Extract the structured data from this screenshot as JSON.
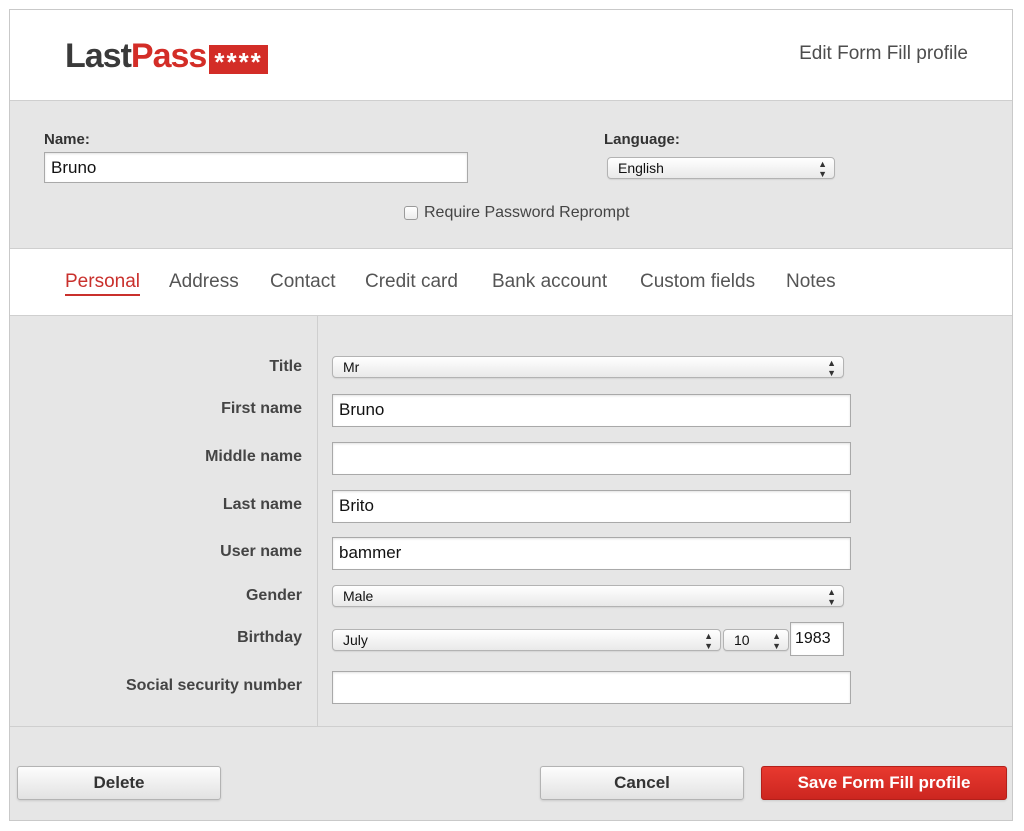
{
  "brand": {
    "logo_last": "Last",
    "logo_pass": "Pass",
    "logo_stars": "****"
  },
  "header": {
    "title": "Edit Form Fill profile"
  },
  "profile": {
    "name_label": "Name:",
    "name_value": "Bruno",
    "language_label": "Language:",
    "language_value": "English",
    "reprompt_label": "Require Password Reprompt",
    "reprompt_checked": false
  },
  "tabs": [
    {
      "label": "Personal",
      "active": true
    },
    {
      "label": "Address"
    },
    {
      "label": "Contact"
    },
    {
      "label": "Credit card"
    },
    {
      "label": "Bank account"
    },
    {
      "label": "Custom fields"
    },
    {
      "label": "Notes"
    }
  ],
  "personal": {
    "title": {
      "label": "Title",
      "value": "Mr"
    },
    "first_name": {
      "label": "First name",
      "value": "Bruno"
    },
    "middle_name": {
      "label": "Middle name",
      "value": ""
    },
    "last_name": {
      "label": "Last name",
      "value": "Brito"
    },
    "user_name": {
      "label": "User name",
      "value": "bammer"
    },
    "gender": {
      "label": "Gender",
      "value": "Male"
    },
    "birthday": {
      "label": "Birthday",
      "month": "July",
      "day": "10",
      "year": "1983"
    },
    "ssn": {
      "label": "Social security number",
      "value": ""
    }
  },
  "actions": {
    "delete": "Delete",
    "cancel": "Cancel",
    "save": "Save Form Fill profile"
  },
  "colors": {
    "accent": "#d32d27",
    "panel": "#e6e6e6"
  }
}
